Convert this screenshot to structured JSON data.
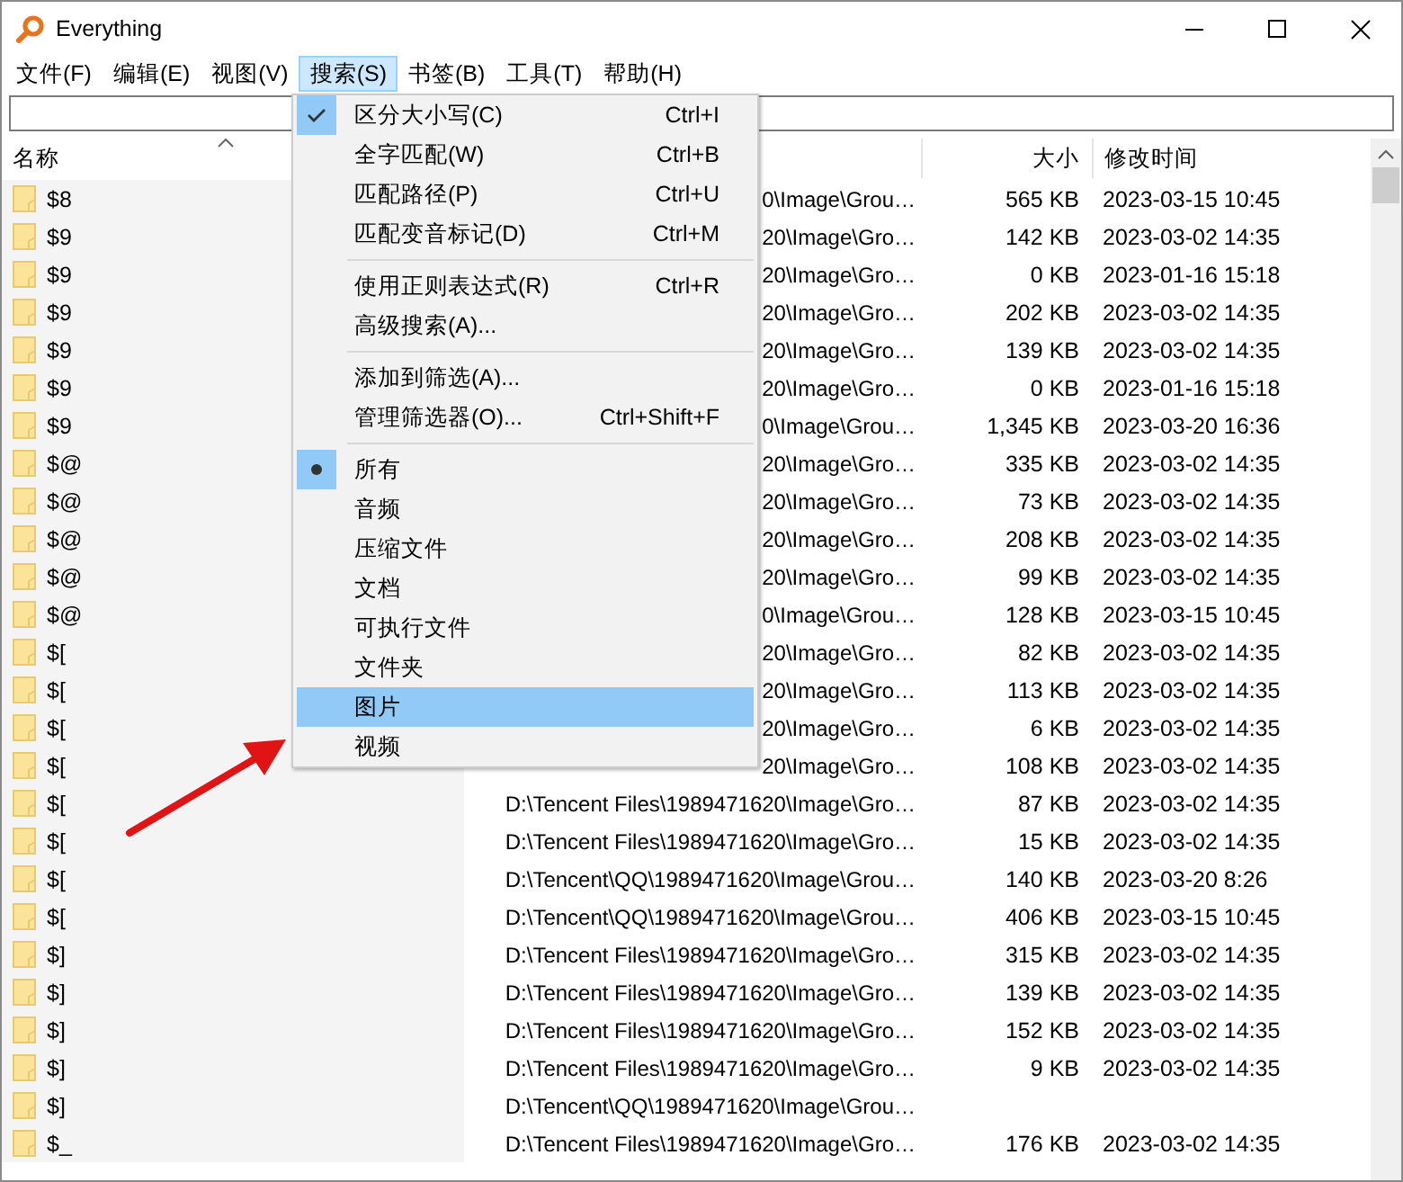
{
  "window": {
    "title": "Everything"
  },
  "menubar": [
    {
      "label": "文件(F)",
      "selected": false
    },
    {
      "label": "编辑(E)",
      "selected": false
    },
    {
      "label": "视图(V)",
      "selected": false
    },
    {
      "label": "搜索(S)",
      "selected": true
    },
    {
      "label": "书签(B)",
      "selected": false
    },
    {
      "label": "工具(T)",
      "selected": false
    },
    {
      "label": "帮助(H)",
      "selected": false
    }
  ],
  "table": {
    "columns": [
      {
        "label": "名称",
        "sorted": true
      },
      {
        "label": "大小",
        "sorted": false
      },
      {
        "label": "修改时间",
        "sorted": false
      }
    ],
    "rows": [
      {
        "name": "$8",
        "path": "0\\Image\\Grou…",
        "size": "565 KB",
        "modified": "2023-03-15 10:45"
      },
      {
        "name": "$9",
        "path": "20\\Image\\Gro…",
        "size": "142 KB",
        "modified": "2023-03-02 14:35"
      },
      {
        "name": "$9",
        "path": "20\\Image\\Gro…",
        "size": "0 KB",
        "modified": "2023-01-16 15:18"
      },
      {
        "name": "$9",
        "path": "20\\Image\\Gro…",
        "size": "202 KB",
        "modified": "2023-03-02 14:35"
      },
      {
        "name": "$9",
        "path": "20\\Image\\Gro…",
        "size": "139 KB",
        "modified": "2023-03-02 14:35"
      },
      {
        "name": "$9",
        "path": "20\\Image\\Gro…",
        "size": "0 KB",
        "modified": "2023-01-16 15:18"
      },
      {
        "name": "$9",
        "path": "0\\Image\\Grou…",
        "size": "1,345 KB",
        "modified": "2023-03-20 16:36"
      },
      {
        "name": "$@",
        "path": "20\\Image\\Gro…",
        "size": "335 KB",
        "modified": "2023-03-02 14:35"
      },
      {
        "name": "$@",
        "path": "20\\Image\\Gro…",
        "size": "73 KB",
        "modified": "2023-03-02 14:35"
      },
      {
        "name": "$@",
        "path": "20\\Image\\Gro…",
        "size": "208 KB",
        "modified": "2023-03-02 14:35"
      },
      {
        "name": "$@",
        "path": "20\\Image\\Gro…",
        "size": "99 KB",
        "modified": "2023-03-02 14:35"
      },
      {
        "name": "$@",
        "path": "0\\Image\\Grou…",
        "size": "128 KB",
        "modified": "2023-03-15 10:45"
      },
      {
        "name": "$[",
        "path": "20\\Image\\Gro…",
        "size": "82 KB",
        "modified": "2023-03-02 14:35"
      },
      {
        "name": "$[",
        "path": "20\\Image\\Gro…",
        "size": "113 KB",
        "modified": "2023-03-02 14:35"
      },
      {
        "name": "$[",
        "path": "20\\Image\\Gro…",
        "size": "6 KB",
        "modified": "2023-03-02 14:35"
      },
      {
        "name": "$[",
        "path": "20\\Image\\Gro…",
        "size": "108 KB",
        "modified": "2023-03-02 14:35"
      },
      {
        "name": "$[",
        "path": "D:\\Tencent Files\\1989471620\\Image\\Gro…",
        "size": "87 KB",
        "modified": "2023-03-02 14:35"
      },
      {
        "name": "$[",
        "path": "D:\\Tencent Files\\1989471620\\Image\\Gro…",
        "size": "15 KB",
        "modified": "2023-03-02 14:35"
      },
      {
        "name": "$[",
        "path": "D:\\Tencent\\QQ\\1989471620\\Image\\Grou…",
        "size": "140 KB",
        "modified": "2023-03-20 8:26"
      },
      {
        "name": "$[",
        "path": "D:\\Tencent\\QQ\\1989471620\\Image\\Grou…",
        "size": "406 KB",
        "modified": "2023-03-15 10:45"
      },
      {
        "name": "$]",
        "path": "D:\\Tencent Files\\1989471620\\Image\\Gro…",
        "size": "315 KB",
        "modified": "2023-03-02 14:35"
      },
      {
        "name": "$]",
        "path": "D:\\Tencent Files\\1989471620\\Image\\Gro…",
        "size": "139 KB",
        "modified": "2023-03-02 14:35"
      },
      {
        "name": "$]",
        "path": "D:\\Tencent Files\\1989471620\\Image\\Gro…",
        "size": "152 KB",
        "modified": "2023-03-02 14:35"
      },
      {
        "name": "$]",
        "path": "D:\\Tencent Files\\1989471620\\Image\\Gro…",
        "size": "9 KB",
        "modified": "2023-03-02 14:35"
      },
      {
        "name": "$]",
        "path": "D:\\Tencent\\QQ\\1989471620\\Image\\Grou…"
      },
      {
        "name": "$_",
        "path": "D:\\Tencent Files\\1989471620\\Image\\Gro…",
        "size": "176 KB",
        "modified": "2023-03-02 14:35"
      }
    ]
  },
  "search_menu": [
    {
      "kind": "check",
      "label": "区分大小写(C)",
      "shortcut": "Ctrl+I",
      "checked": true,
      "highlighted": false
    },
    {
      "kind": "check",
      "label": "全字匹配(W)",
      "shortcut": "Ctrl+B",
      "checked": false,
      "highlighted": false
    },
    {
      "kind": "check",
      "label": "匹配路径(P)",
      "shortcut": "Ctrl+U",
      "checked": false,
      "highlighted": false
    },
    {
      "kind": "check",
      "label": "匹配变音标记(D)",
      "shortcut": "Ctrl+M",
      "checked": false,
      "highlighted": false
    },
    {
      "kind": "separator"
    },
    {
      "kind": "check",
      "label": "使用正则表达式(R)",
      "shortcut": "Ctrl+R",
      "checked": false,
      "highlighted": false
    },
    {
      "kind": "check",
      "label": "高级搜索(A)...",
      "checked": false,
      "highlighted": false
    },
    {
      "kind": "separator"
    },
    {
      "kind": "check",
      "label": "添加到筛选(A)...",
      "checked": false,
      "highlighted": false
    },
    {
      "kind": "check",
      "label": "管理筛选器(O)...",
      "shortcut": "Ctrl+Shift+F",
      "checked": false,
      "highlighted": false
    },
    {
      "kind": "separator"
    },
    {
      "kind": "radio",
      "label": "所有",
      "checked": true,
      "highlighted": false
    },
    {
      "kind": "radio",
      "label": "音频",
      "checked": false,
      "highlighted": false
    },
    {
      "kind": "radio",
      "label": "压缩文件",
      "checked": false,
      "highlighted": false
    },
    {
      "kind": "radio",
      "label": "文档",
      "checked": false,
      "highlighted": false
    },
    {
      "kind": "radio",
      "label": "可执行文件",
      "checked": false,
      "highlighted": false
    },
    {
      "kind": "radio",
      "label": "文件夹",
      "checked": false,
      "highlighted": false
    },
    {
      "kind": "radio",
      "label": "图片",
      "checked": false,
      "highlighted": true
    },
    {
      "kind": "radio",
      "label": "视频",
      "checked": false,
      "highlighted": false
    }
  ]
}
